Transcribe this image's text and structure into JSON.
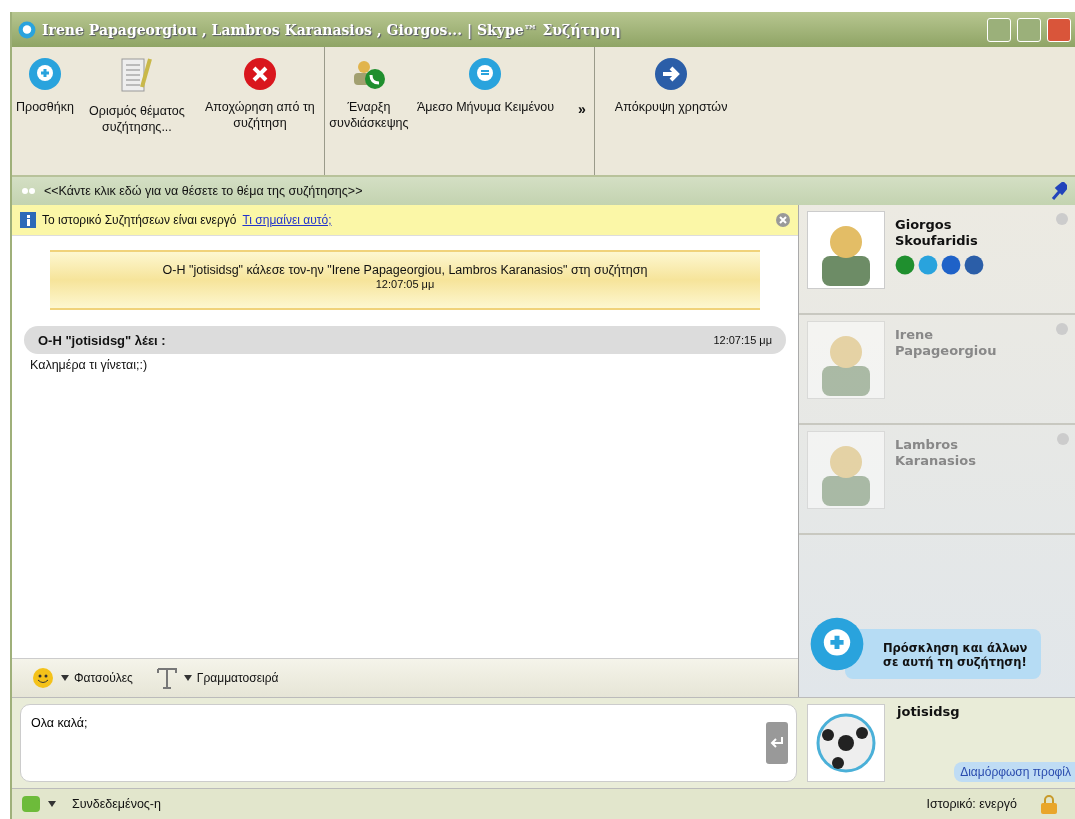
{
  "window": {
    "title": "Irene Papageorgiou , Lambros Karanasios , Giorgos... | Skype™ Συζήτηση"
  },
  "toolbar": {
    "items": [
      {
        "kind": "add",
        "label": "Προσθήκη"
      },
      {
        "kind": "topic",
        "label": "Ορισμός θέματος συζήτησης..."
      },
      {
        "kind": "leave",
        "label": "Αποχώρηση από τη συζήτηση"
      },
      {
        "kind": "conference",
        "label": "Έναρξη συνδιάσκεψης"
      },
      {
        "kind": "message",
        "label": "Άμεσο Μήνυμα Κειμένου"
      }
    ],
    "more": "»",
    "right_items": [
      {
        "kind": "hide",
        "label": "Απόκρυψη χρηστών"
      }
    ]
  },
  "topic_bar": {
    "text": "<<Κάντε κλικ εδώ για να θέσετε το θέμα της συζήτησης>>"
  },
  "notice": {
    "text": "Το ιστορικό Συζητήσεων είναι ενεργό",
    "link": "Τι σημαίνει αυτό;"
  },
  "messages": [
    {
      "kind": "event",
      "text": "Ο-Η \"jotisidsg\" κάλεσε τον-ην \"Irene Papageorgiou, Lambros Karanasios\" στη συζήτηση",
      "time": "12:07:05 μμ"
    },
    {
      "kind": "chat",
      "sender": "Ο-Η \"jotisidsg\" λέει :",
      "time": "12:07:15 μμ",
      "text": "Καλημέρα τι γίνεται;:)"
    }
  ],
  "format_bar": {
    "items": [
      {
        "kind": "emoticons",
        "label": "Φατσούλες"
      },
      {
        "kind": "font",
        "label": "Γραμματοσειρά"
      }
    ]
  },
  "participants": [
    {
      "name": "Giorgos Skoufaridis",
      "active": true
    },
    {
      "name": "Irene Papageorgiou",
      "active": false
    },
    {
      "name": "Lambros Karanasios",
      "active": false
    }
  ],
  "invite": {
    "text": "Πρόσκληση και άλλων σε αυτή τη συζήτηση!"
  },
  "input": {
    "value": "Ολα καλά;"
  },
  "me": {
    "name": "jotisidsg",
    "profile_link": "Διαμόρφωση προφίλ"
  },
  "status_bar": {
    "status": "Συνδεδεμένος-η",
    "history": "Ιστορικό: ενεργό"
  }
}
